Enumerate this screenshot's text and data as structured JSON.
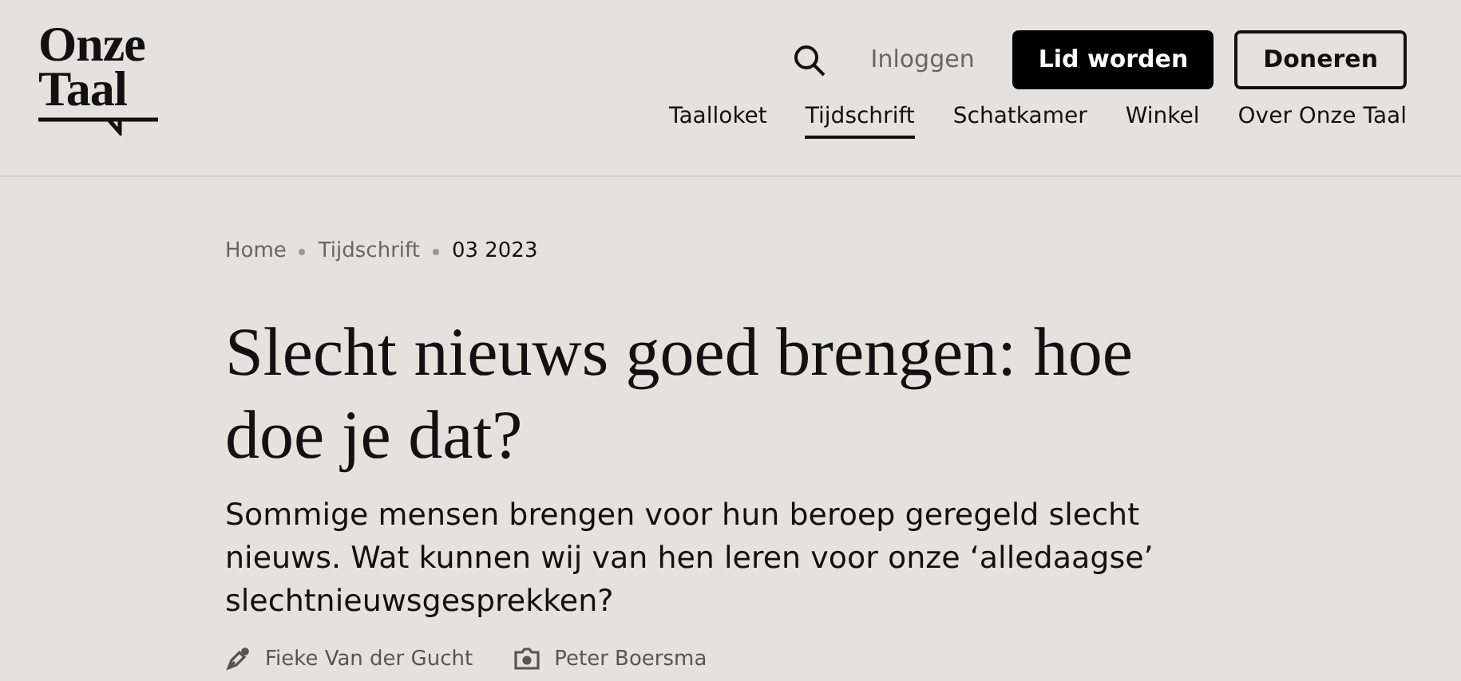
{
  "logo": {
    "lines": [
      "Onze",
      "Taal"
    ]
  },
  "header": {
    "login": "Inloggen",
    "primary_button": "Lid worden",
    "secondary_button": "Doneren"
  },
  "nav": [
    {
      "label": "Taalloket",
      "selected": false
    },
    {
      "label": "Tijdschrift",
      "selected": true
    },
    {
      "label": "Schatkamer",
      "selected": false
    },
    {
      "label": "Winkel",
      "selected": false
    },
    {
      "label": "Over Onze Taal",
      "selected": false
    }
  ],
  "breadcrumbs": [
    {
      "label": "Home",
      "selected": false
    },
    {
      "label": "Tijdschrift",
      "selected": false
    },
    {
      "label": "03 2023",
      "selected": true
    }
  ],
  "article": {
    "title": "Slecht nieuws goed brengen: hoe doe je dat?",
    "intro": "Sommige mensen brengen voor hun beroep geregeld slecht nieuws. Wat kunnen wij van hen leren voor onze ‘alledaagse’ slechtnieuwsgesprekken?"
  },
  "credits": [
    {
      "kind": "author",
      "name": "Fieke Van der Gucht"
    },
    {
      "kind": "photographer",
      "name": "Peter Boersma"
    }
  ]
}
